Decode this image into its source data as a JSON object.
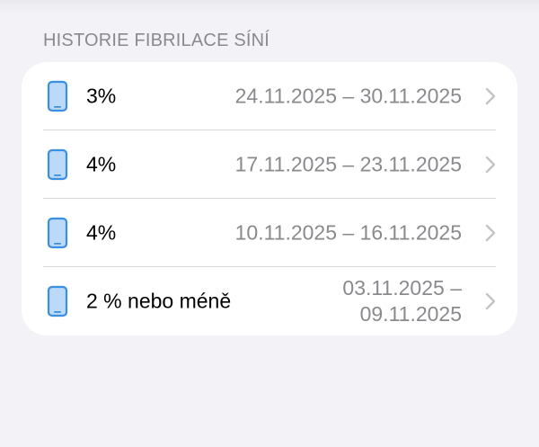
{
  "section": {
    "title": "HISTORIE FIBRILACE SÍNÍ"
  },
  "rows": [
    {
      "value": "3%",
      "date": "24.11.2025 – 30.11.2025",
      "icon": "iphone-icon"
    },
    {
      "value": "4%",
      "date": "17.11.2025 – 23.11.2025",
      "icon": "iphone-icon"
    },
    {
      "value": "4%",
      "date": "10.11.2025 – 16.11.2025",
      "icon": "iphone-icon"
    },
    {
      "value": "2 % nebo méně",
      "date": "03.11.2025 – 09.11.2025",
      "icon": "iphone-icon"
    }
  ],
  "colors": {
    "background": "#f2f2f7",
    "card": "#ffffff",
    "icon": "#3b8fe0",
    "secondary_text": "#8a8a8e"
  }
}
